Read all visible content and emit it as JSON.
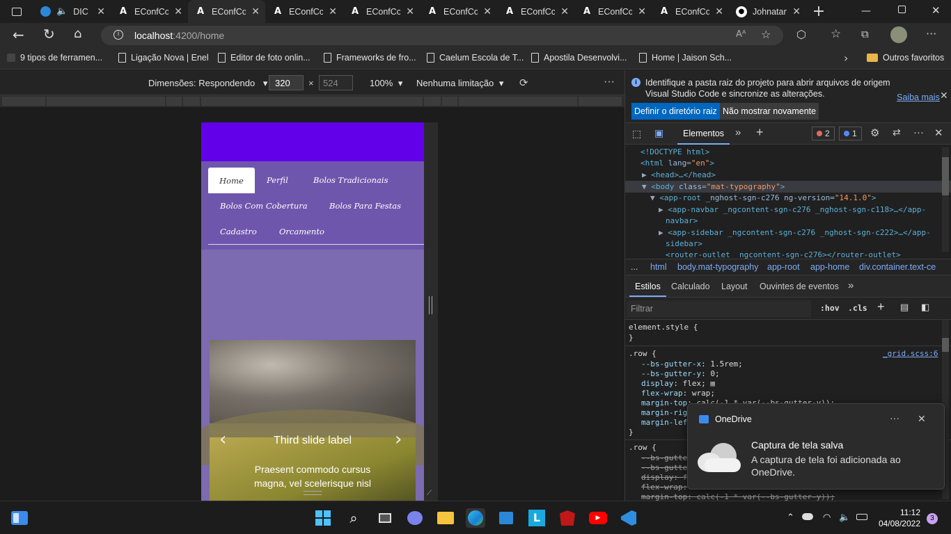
{
  "browser": {
    "tabs": [
      {
        "title": "DIC",
        "icon": "edge-icon",
        "active": false
      },
      {
        "title": "EConfCo",
        "icon": "angular-icon",
        "active": false
      },
      {
        "title": "EConfCo",
        "icon": "angular-icon",
        "active": true
      },
      {
        "title": "EConfCo",
        "icon": "angular-icon",
        "active": false
      },
      {
        "title": "EConfCo",
        "icon": "angular-icon",
        "active": false
      },
      {
        "title": "EConfCo",
        "icon": "angular-icon",
        "active": false
      },
      {
        "title": "EConfCo",
        "icon": "angular-icon",
        "active": false
      },
      {
        "title": "EConfCo",
        "icon": "angular-icon",
        "active": false
      },
      {
        "title": "EConfCo",
        "icon": "angular-icon",
        "active": false
      },
      {
        "title": "Johnatan",
        "icon": "github-icon",
        "active": false
      }
    ],
    "new_tab": "+",
    "url_host": "localhost",
    "url_rest": ":4200/home",
    "bookmarks": [
      "9 tipos de ferramen...",
      "Ligação Nova | Enel",
      "Editor de foto onlin...",
      "Frameworks de fro...",
      "Caelum Escola de T...",
      "Apostila Desenvolvi...",
      "Home | Jaison Sch..."
    ],
    "other_favorites": "Outros favoritos"
  },
  "device_toolbar": {
    "dimensions_label": "Dimensões: Respondendo",
    "width": "320",
    "times": "×",
    "height_placeholder": "524",
    "zoom": "100%",
    "throttle": "Nenhuma limitação"
  },
  "page": {
    "nav": {
      "home": "Home",
      "perfil": "Perfil",
      "bolos_tradicionais": "Bolos Tradicionais",
      "bolos_cobertura": "Bolos Com Cobertura",
      "bolos_festas": "Bolos Para Festas",
      "cadastro": "Cadastro",
      "orcamento": "Orcamento"
    },
    "carousel": {
      "label": "Third slide label",
      "text_line1": "Praesent commodo cursus",
      "text_line2": "magna, vel scelerisque nisl"
    }
  },
  "devtools": {
    "info_text_line1": "Identifique a pasta raiz do projeto para abrir arquivos de origem",
    "info_text_line2": "Visual Studio Code e sincronize as alterações.",
    "learn_more": "Saiba mais",
    "set_root": "Definir o diretório raiz",
    "dont_show": "Não mostrar novamente",
    "main_tab": "Elementos",
    "errors": "2",
    "messages": "1",
    "dom": {
      "doctype": "<!DOCTYPE html>",
      "html_open": "<html",
      "lang_attr": "lang",
      "lang_val": "\"en\"",
      "head": "<head>…</head>",
      "body_open": "<body",
      "body_class": "class",
      "body_class_val": "\"mat-typography\"",
      "app_root": "<app-root",
      "app_root_attr": "_nghost-sgn-c276 ng-version=",
      "app_root_ver": "\"14.1.0\"",
      "navbar_a": "<app-navbar _ngcontent-sgn-c276 _nghost-sgn-c118>…</app-",
      "navbar_b": "navbar>",
      "sidebar_a": "<app-sidebar _ngcontent-sgn-c276 _nghost-sgn-c222>…</app-",
      "sidebar_b": "sidebar>",
      "router": "<router-outlet _ngcontent-sgn-c276></router-outlet>"
    },
    "breadcrumbs": [
      "...",
      "html",
      "body.mat-typography",
      "app-root",
      "app-home",
      "div.container.text-ce"
    ],
    "style_tabs": [
      "Estilos",
      "Calculado",
      "Layout",
      "Ouvintes de eventos"
    ],
    "filter_placeholder": "Filtrar",
    "hov": ":hov",
    "cls": ".cls",
    "styles": {
      "element_style": "element.style {",
      "close": "}",
      "row_sel": ".row {",
      "row_source": "_grid.scss:6",
      "gutter_x_p": "--bs-gutter-x",
      "gutter_x_v": ": 1.5rem;",
      "gutter_y_p": "--bs-gutter-y",
      "gutter_y_v": ": 0;",
      "display_p": "display",
      "display_v": ": flex;",
      "wrap_p": "flex-wrap",
      "wrap_v": ": wrap;",
      "mtop_p": "margin-top",
      "mtop_v": ": calc(-1 * var(--bs-gutter-y));",
      "mright": "margin-rig",
      "mleft": "margin-lef",
      "row2_sel": ".row {",
      "s_gx": "--bs-gutte",
      "s_gy": "--bs-gutte",
      "s_disp": "display: f",
      "s_wrap": "flex-wrap:",
      "s_mtop": "margin-top: calc(-1 * var(--bs-gutter-y));"
    }
  },
  "toast": {
    "app": "OneDrive",
    "title": "Captura de tela salva",
    "body_line1": "A captura de tela foi adicionada ao",
    "body_line2": "OneDrive."
  },
  "taskbar": {
    "time": "11:12",
    "date": "04/08/2022",
    "notifications": "3"
  },
  "colors": {
    "purple_header": "#6200ea",
    "nav_bg": "#6f56ad",
    "page_bg": "#7c6bb0",
    "accent_blue": "#0067c0"
  }
}
